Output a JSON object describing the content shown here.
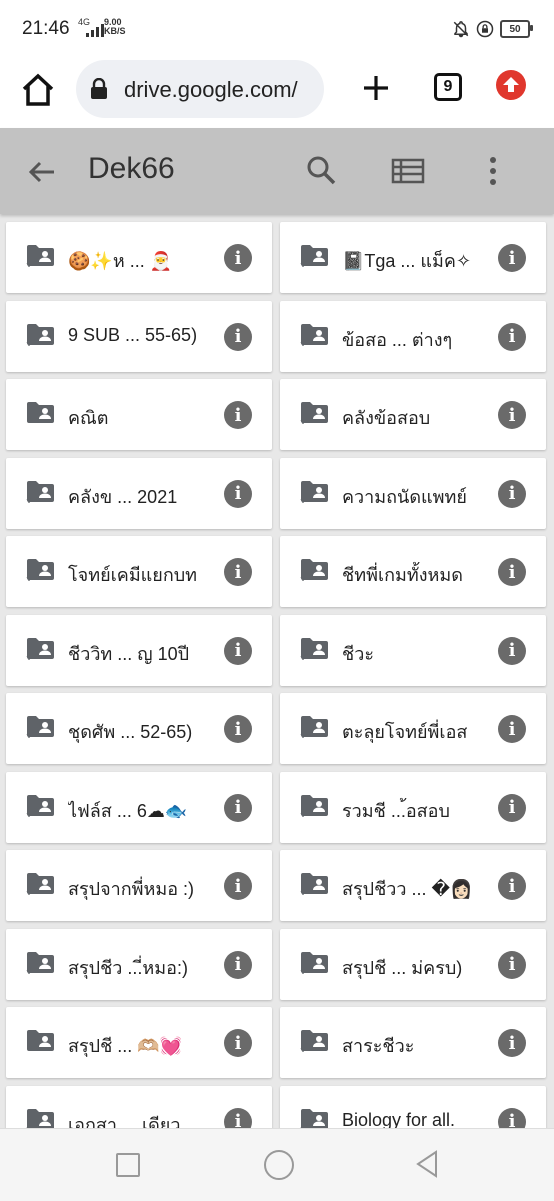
{
  "status_bar": {
    "time": "21:46",
    "network": "4G",
    "speed_value": "9.00",
    "speed_unit": "KB/S",
    "battery": "50"
  },
  "browser": {
    "url": "drive.google.com/",
    "tab_count": "9"
  },
  "app_bar": {
    "title": "Dek66"
  },
  "folders": [
    {
      "name": "🍪✨ห ... 🎅",
      "shared": true
    },
    {
      "name": "📓Tga ... แม็ค✧",
      "shared": true
    },
    {
      "name": "9 SUB ... 55-65)",
      "shared": true
    },
    {
      "name": "ข้อสอ ... ต่างๆ",
      "shared": true
    },
    {
      "name": "คณิต",
      "shared": false
    },
    {
      "name": "คลังข้อสอบ",
      "shared": true
    },
    {
      "name": "คลังข ... 2021",
      "shared": true
    },
    {
      "name": "ความถนัดแพทย์",
      "shared": true
    },
    {
      "name": "โจทย์เคมีแยกบท",
      "shared": true
    },
    {
      "name": "ชีทพี่เกมทั้งหมด",
      "shared": true
    },
    {
      "name": "ชีววิท ... ญ 10ปี",
      "shared": true
    },
    {
      "name": "ชีวะ",
      "shared": true
    },
    {
      "name": "ชุดศัพ ... 52-65)",
      "shared": true
    },
    {
      "name": "ตะลุยโจทย์พี่เอส",
      "shared": true
    },
    {
      "name": "ไฟล์ส ... 6☁🐟",
      "shared": true
    },
    {
      "name": "รวมชี ...้อสอบ",
      "shared": true
    },
    {
      "name": "สรุปจากพี่หมอ :)",
      "shared": true
    },
    {
      "name": "สรุปชีวว ... �👩🏻",
      "shared": true
    },
    {
      "name": "สรุปชีว ...ี่หมอ:)",
      "shared": true
    },
    {
      "name": "สรุปชี ... ม่ครบ)",
      "shared": true
    },
    {
      "name": "สรุปชี ... 🫶🏼💓",
      "shared": false
    },
    {
      "name": "สาระชีวะ",
      "shared": true
    },
    {
      "name": "เอกสา ... เดียว",
      "shared": true
    },
    {
      "name": "Biology for all.",
      "shared": true
    }
  ],
  "colors": {
    "app_bar_bg": "#c2c2c2",
    "page_bg": "#e8e8e8",
    "info_icon": "#6a6a6a",
    "update_icon": "#e0372d"
  }
}
